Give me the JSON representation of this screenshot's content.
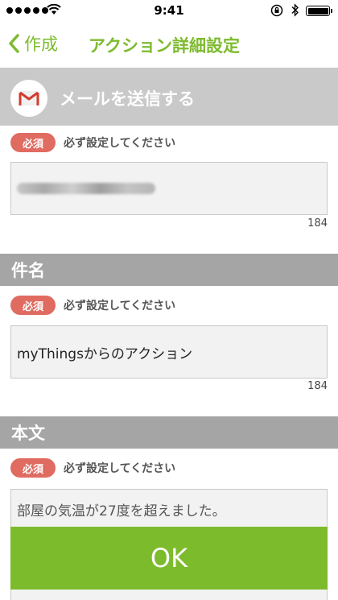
{
  "status_bar": {
    "time": "9:41"
  },
  "nav": {
    "back_label": "作成",
    "title": "アクション詳細設定"
  },
  "service": {
    "icon": "gmail-icon",
    "title": "メールを送信する"
  },
  "required_label": "必須",
  "required_hint": "必ず設定してください",
  "email_section": {
    "value": "(blurred email address)",
    "counter": "184"
  },
  "subject_section": {
    "header": "件名",
    "value": "myThingsからのアクション",
    "counter": "184"
  },
  "body_section": {
    "header": "本文",
    "value": "部屋の気温が27度を超えました。"
  },
  "ok_button": {
    "label": "OK"
  },
  "colors": {
    "accent": "#7dbb2e",
    "badge": "#e06b61",
    "section_header": "#a5a5a5",
    "service_row": "#c9c9c9"
  }
}
